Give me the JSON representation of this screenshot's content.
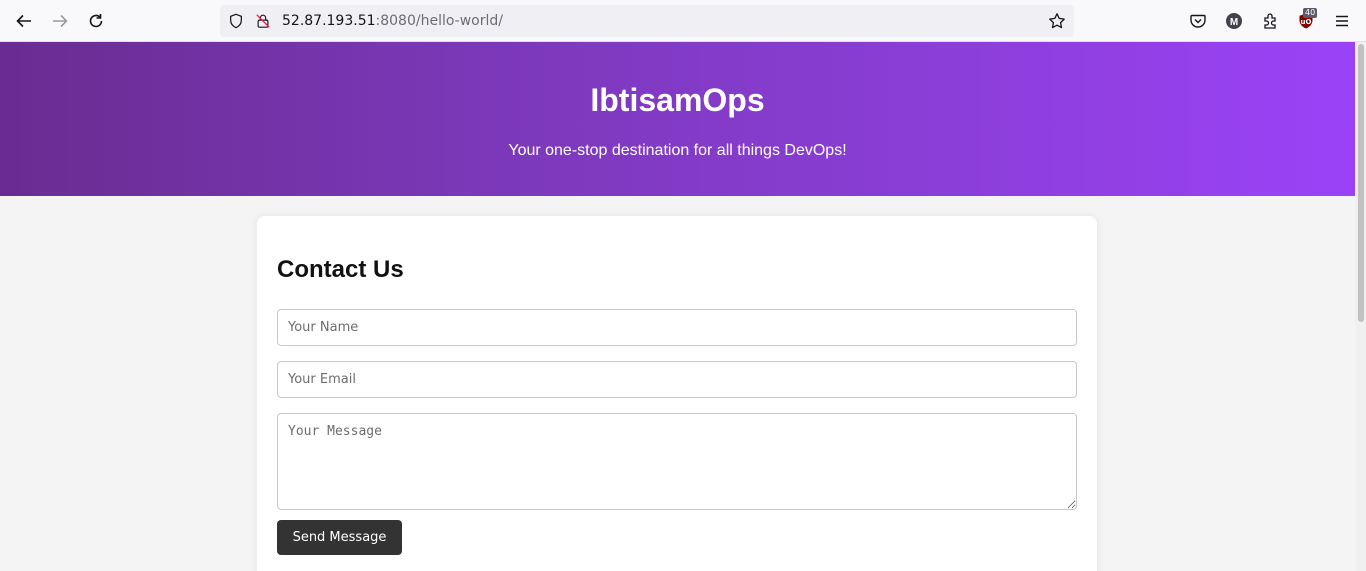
{
  "browser": {
    "url_host": "52.87.193.51",
    "url_rest": ":8080/hello-world/",
    "extension_badge": "40",
    "icons": [
      "back-icon",
      "forward-icon",
      "reload-icon",
      "shield-icon",
      "insecure-lock-icon",
      "bookmark-star-icon",
      "pocket-icon",
      "account-icon",
      "extensions-icon",
      "ublock-icon",
      "menu-icon"
    ],
    "account_initial": "M"
  },
  "hero": {
    "title": "IbtisamOps",
    "tagline": "Your one-stop destination for all things DevOps!",
    "gradient_start": "#6a2c91",
    "gradient_end": "#9b42f8"
  },
  "contact": {
    "heading": "Contact Us",
    "name_placeholder": "Your Name",
    "email_placeholder": "Your Email",
    "message_placeholder": "Your Message",
    "send_label": "Send Message"
  }
}
